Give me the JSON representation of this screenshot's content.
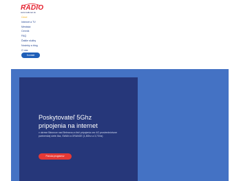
{
  "brand": {
    "name": "RADIO",
    "tagline": "www.radionet.sk",
    "color": "#e41f2d"
  },
  "nav": {
    "items": [
      {
        "label": "Úvod",
        "active": true
      },
      {
        "label": "Internet a TV"
      },
      {
        "label": "Mestská"
      },
      {
        "label": "Cenník"
      },
      {
        "label": "FAQ"
      },
      {
        "label": "Ďalšie služby"
      },
      {
        "label": "Novinky a blog"
      },
      {
        "label": "O nás"
      }
    ],
    "contact_label": "Kontakt"
  },
  "hero": {
    "title_line1": "Poskytovateľ 5Ghz",
    "title_line2": "pripojenia na internet",
    "description": "v okrese Bánovce nad Bebravou a tiež pripojenia cez 4G prostredníctvom partnerskej siete 4ka, SWAN a ORANGE (1,8Ghz a 3,7Ghz)",
    "cta_label": "Ponuka programov"
  },
  "colors": {
    "nav_active": "#f2b01e",
    "nav_text": "#1d3f8f",
    "hero_bg": "#4472c4",
    "hero_card": "#26377a",
    "cta": "#e53935",
    "contact_button": "#1f5fb8"
  }
}
